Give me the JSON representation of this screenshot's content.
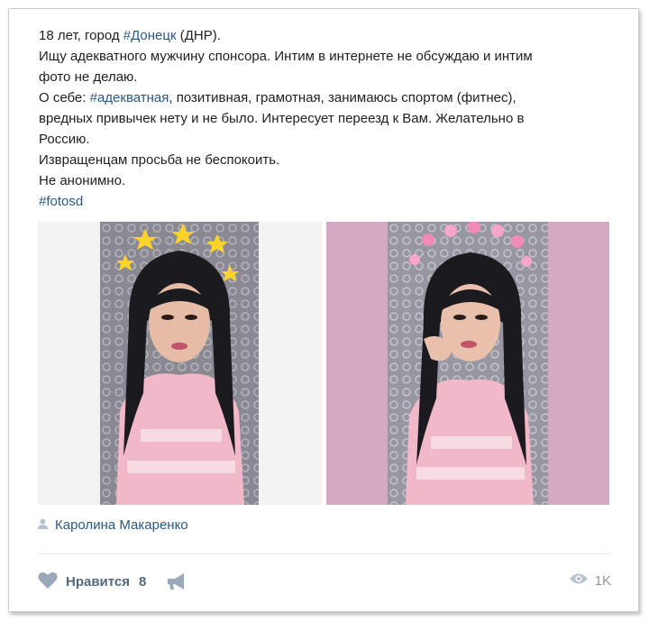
{
  "post": {
    "line1_pre": "18 лет, город ",
    "line1_tag": "#Донецк",
    "line1_post": " (ДНР).",
    "line2": "Ищу адекватного мужчину спонсора. Интим в интернете не обсуждаю и интим",
    "line3": "фото не делаю.",
    "line4_pre": "О себе: ",
    "line4_tag": "#адекватная",
    "line4_post": ", позитивная, грамотная, занимаюсь спортом (фитнес),",
    "line5": "вредных привычек нету и не было. Интересует переезд к Вам. Желательно в",
    "line6": "Россию.",
    "line7": "Извращенцам просьба не беспокоить.",
    "line8": "Не анонимно.",
    "hashtag": "#fotosd"
  },
  "author": {
    "icon": "person-icon",
    "name": "Каролина Макаренко"
  },
  "footer": {
    "like_icon": "heart-icon",
    "like_label": "Нравится",
    "like_count": "8",
    "share_icon": "megaphone-icon",
    "views_icon": "eye-icon",
    "views_count": "1K"
  },
  "colors": {
    "link": "#2a5885",
    "text": "#1f1f1f",
    "muted": "#939393",
    "photo2_background": "#d5a9c1"
  }
}
